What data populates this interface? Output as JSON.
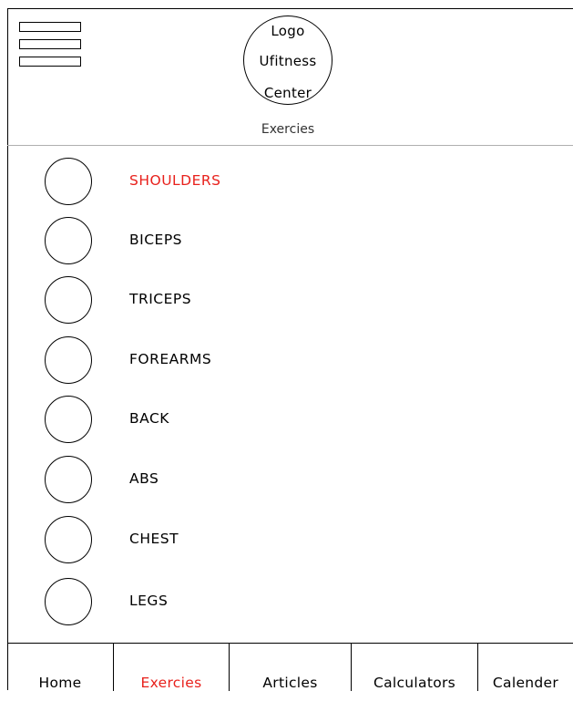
{
  "header": {
    "logo_lines": [
      "Logo",
      "Ufitness",
      "Center"
    ],
    "page_title": "Exercies"
  },
  "menu_icon": "hamburger-menu-icon",
  "muscle_groups": [
    {
      "label": "SHOULDERS",
      "active": true
    },
    {
      "label": "BICEPS",
      "active": false
    },
    {
      "label": "TRICEPS",
      "active": false
    },
    {
      "label": "FOREARMS",
      "active": false
    },
    {
      "label": "BACK",
      "active": false
    },
    {
      "label": "ABS",
      "active": false
    },
    {
      "label": "CHEST",
      "active": false
    },
    {
      "label": "LEGS",
      "active": false
    }
  ],
  "bottom_nav": [
    {
      "label": "Home",
      "active": false
    },
    {
      "label": "Exercies",
      "active": true
    },
    {
      "label": "Articles",
      "active": false
    },
    {
      "label": "Calculators",
      "active": false
    },
    {
      "label": "Calender",
      "active": false
    }
  ],
  "colors": {
    "active": "#e8211c",
    "border": "#000000",
    "divider": "#b0b0b0"
  }
}
